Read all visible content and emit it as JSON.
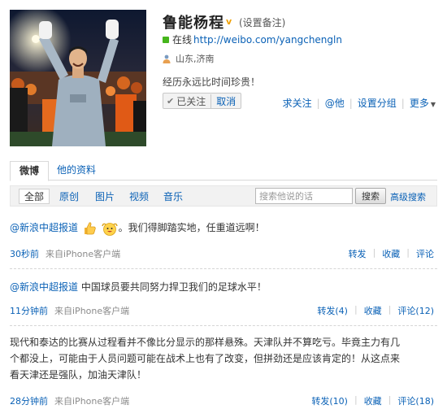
{
  "profile": {
    "name": "鲁能杨程",
    "verified_mark": "v",
    "remark_label": "(设置备注)",
    "online_label": "在线",
    "url": "http://weibo.com/yangchengln",
    "location": "山东,济南",
    "bio": "经历永远比时间珍贵！",
    "followed_label": "已关注",
    "followed_check": "✔",
    "cancel_label": "取消"
  },
  "actions": {
    "follow_back": "求关注",
    "mention": "@他",
    "set_group": "设置分组",
    "more": "更多"
  },
  "tabs": {
    "weibo": "微博",
    "profile": "他的资料"
  },
  "filters": {
    "all": "全部",
    "original": "原创",
    "pictures": "图片",
    "video": "视频",
    "music": "音乐",
    "search_placeholder": "搜索他说的话",
    "search_button": "搜索",
    "advanced_search": "高级搜索"
  },
  "posts": [
    {
      "author": "@新浪中超报道",
      "text": "。我们得脚踏实地，任重道远啊！",
      "emoji": [
        "thumbs-up-icon",
        "cheering-face-icon"
      ],
      "time": "30秒前",
      "source": "来自iPhone客户端",
      "repost": "转发",
      "favorite": "收藏",
      "comment": "评论"
    },
    {
      "author": "@新浪中超报道",
      "text": " 中国球员要共同努力捍卫我们的足球水平！",
      "time": "11分钟前",
      "source": "来自iPhone客户端",
      "repost": "转发(4)",
      "favorite": "收藏",
      "comment": "评论(12)"
    },
    {
      "text_lines": [
        "现代和泰达的比赛从过程看并不像比分显示的那样悬殊。天津队并不算吃亏。毕竟主力有几",
        "个都没上，可能由于人员问题可能在战术上也有了改变，但拼劲还是应该肯定的！从这点来",
        "看天津还是强队，加油天津队！"
      ],
      "time": "28分钟前",
      "source": "来自iPhone客户端",
      "repost": "转发(10)",
      "favorite": "收藏",
      "comment": "评论(18)"
    }
  ]
}
